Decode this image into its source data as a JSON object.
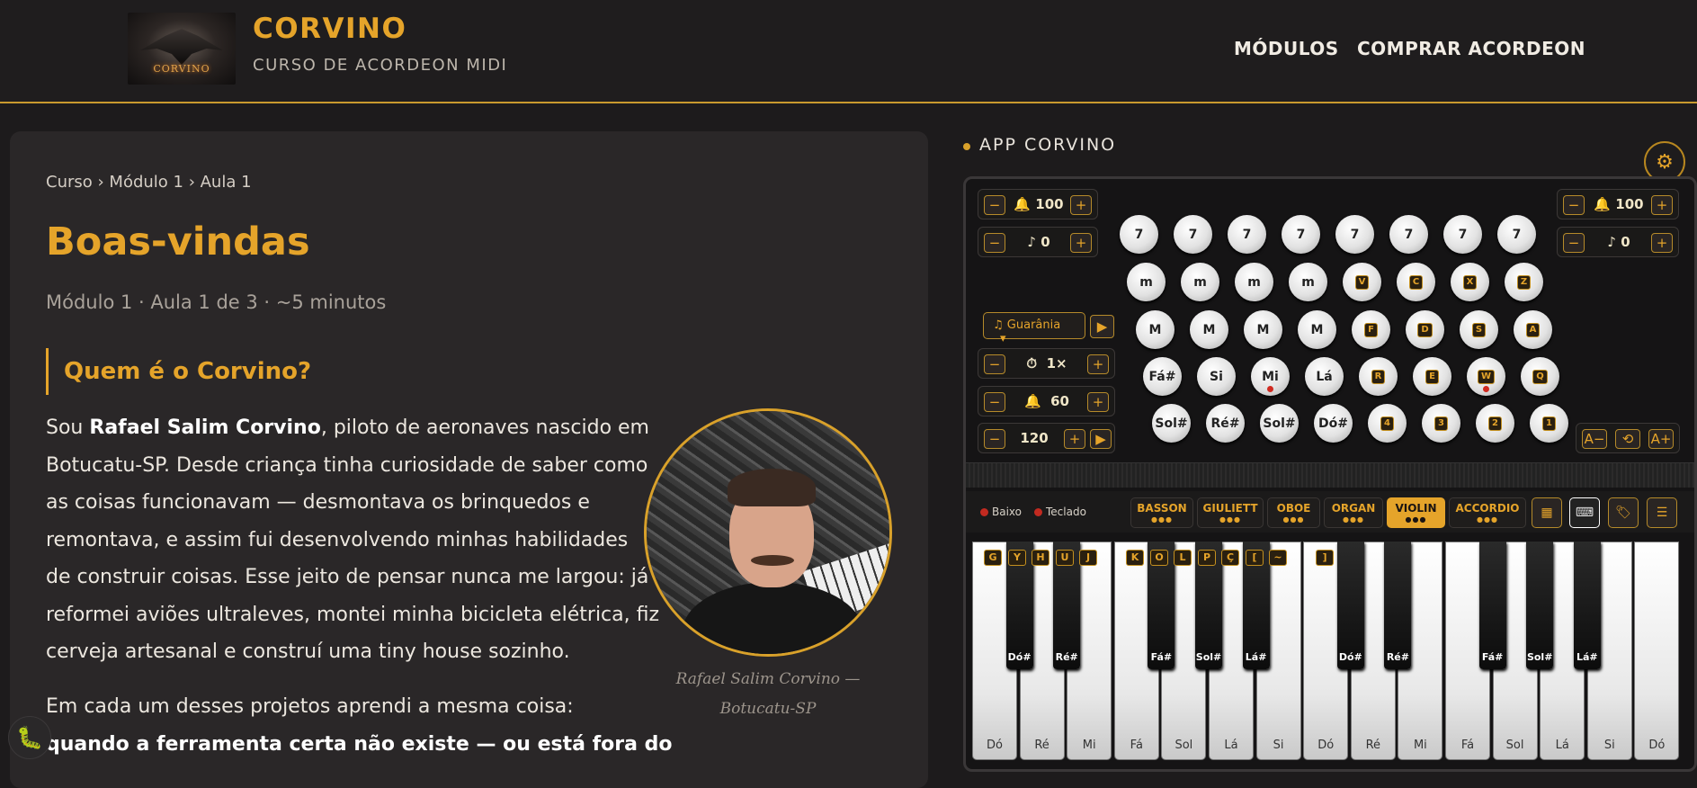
{
  "header": {
    "brand": "CORVINO",
    "tagline": "CURSO DE ACORDEON MIDI",
    "logo_text": "CORVINO",
    "nav": [
      "MÓDULOS",
      "COMPRAR ACORDEON"
    ]
  },
  "lesson": {
    "breadcrumb": "Curso › Módulo 1 › Aula 1",
    "title": "Boas-vindas",
    "meta": "Módulo 1 · Aula 1 de 3 · ~5 minutos",
    "section_title": "Quem é o Corvino?",
    "p1_pre": "Sou ",
    "p1_bold": "Rafael Salim Corvino",
    "p1_lines": [
      ", piloto de aeronaves nascido em",
      "Botucatu-SP. Desde criança tinha curiosidade de saber como",
      "as coisas funcionavam — desmontava os brinquedos e",
      "remontava, e assim fui desenvolvendo minhas habilidades",
      "de construir coisas. Esse jeito de pensar nunca me largou: já",
      "reformei aviões ultraleves, montei minha bicicleta elétrica, fiz",
      "cerveja artesanal e construí uma tiny house sozinho."
    ],
    "p2": "Em cada um desses projetos aprendi a mesma coisa:",
    "p2_bold": "quando a ferramenta certa não existe — ou está fora do",
    "caption": [
      "Rafael Salim Corvino —",
      "Botucatu-SP"
    ]
  },
  "app": {
    "title": "APP CORVINO",
    "left_volume": "100",
    "left_transpose": "0",
    "right_volume": "100",
    "right_transpose": "0",
    "preset": "Guarânia",
    "tempo_mult": "1×",
    "metronome_vol": "60",
    "bpm": "120",
    "font_buttons": [
      "A−",
      "⟲",
      "A+"
    ],
    "bass_rows": [
      [
        "7",
        "7",
        "7",
        "7",
        "7",
        "7",
        "7",
        "7"
      ],
      [
        "m",
        "m",
        "m",
        "m",
        "V",
        "C",
        "X",
        "Z"
      ],
      [
        "M",
        "M",
        "M",
        "M",
        "F",
        "D",
        "S",
        "A"
      ],
      [
        "Fá#",
        "Si",
        "Mi",
        "Lá",
        "R",
        "E",
        "W",
        "Q"
      ],
      [
        "Sol#",
        "Ré#",
        "Sol#",
        "Dó#",
        "4",
        "3",
        "2",
        "1"
      ]
    ],
    "source_labels": [
      "Baixo",
      "Teclado"
    ],
    "registers": [
      "BASSON",
      "GIULIETT",
      "OBOE",
      "ORGAN",
      "VIOLIN",
      "ACCORDIO"
    ],
    "active_register": "VIOLIN",
    "white_keys": [
      "Dó",
      "Ré",
      "Mi",
      "Fá",
      "Sol",
      "Lá",
      "Si",
      "Dó",
      "Ré",
      "Mi",
      "Fá",
      "Sol",
      "Lá",
      "Si",
      "Dó"
    ],
    "black_keys": [
      "Dó#",
      "Ré#",
      "Fá#",
      "Sol#",
      "Lá#",
      "Dó#",
      "Ré#",
      "Fá#",
      "Sol#",
      "Lá#"
    ],
    "key_tags": [
      "G",
      "Y",
      "H",
      "U",
      "J",
      "K",
      "O",
      "L",
      "P",
      "Ç",
      "[",
      "~",
      "]"
    ]
  },
  "icons": {
    "gear": "gear-icon",
    "play": "play-icon",
    "bell": "bell-icon",
    "note": "note-icon",
    "timer": "timer-icon",
    "bug": "bug-icon",
    "keyboard": "keyboard-icon",
    "tag": "tag-icon",
    "menu": "menu-icon"
  }
}
